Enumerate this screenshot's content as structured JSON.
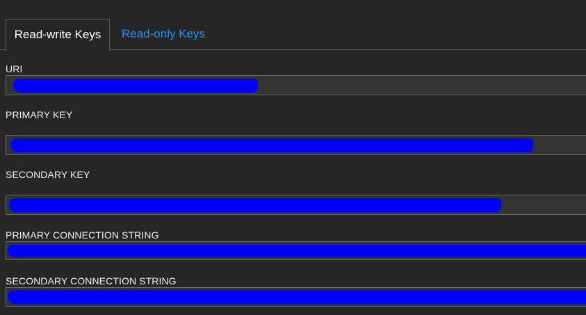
{
  "tabs": {
    "read_write": "Read-write Keys",
    "read_only": "Read-only Keys"
  },
  "fields": {
    "uri": {
      "label": "URI",
      "value_redacted": true
    },
    "primary_key": {
      "label": "PRIMARY KEY",
      "value_redacted": true
    },
    "secondary_key": {
      "label": "SECONDARY KEY",
      "value_redacted": true
    },
    "primary_connection_string": {
      "label": "PRIMARY CONNECTION STRING",
      "value_redacted": true
    },
    "secondary_connection_string": {
      "label": "SECONDARY CONNECTION STRING",
      "value_redacted": true
    }
  },
  "colors": {
    "background": "#262626",
    "field_background": "#333333",
    "field_border": "#6b6b6b",
    "active_tab_text": "#ffffff",
    "inactive_tab_text": "#1e8fff",
    "redaction": "#0000ff"
  }
}
